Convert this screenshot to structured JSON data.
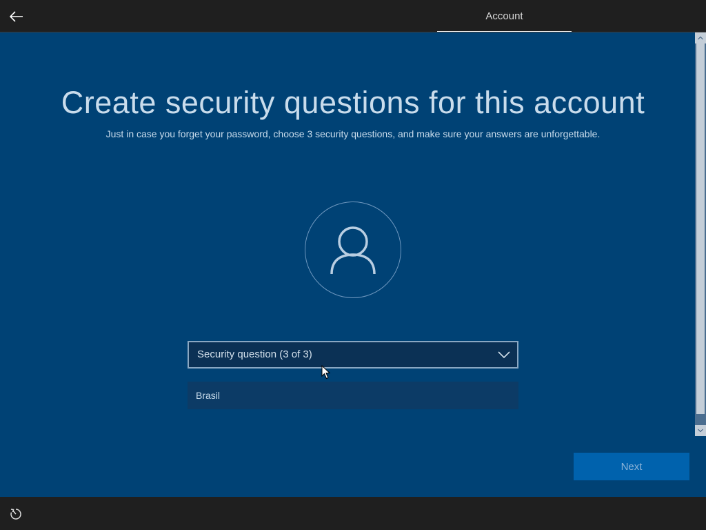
{
  "header": {
    "back_icon": "back-arrow-icon",
    "tab_label": "Account"
  },
  "main": {
    "title": "Create security questions for this account",
    "subtitle": "Just in case you forget your password, choose 3 security questions, and make sure your answers are unforgettable.",
    "avatar_icon": "user-icon",
    "security_question": {
      "selected": "Security question (3 of 3)",
      "icon": "chevron-down-icon"
    },
    "answer": {
      "value": "Brasil"
    },
    "next_label": "Next"
  },
  "footer": {
    "ease_of_access_icon": "ease-of-access-icon"
  },
  "colors": {
    "background": "#004275",
    "bars": "#1f1f1f",
    "button": "#0062ad",
    "text": "#c9dcec"
  }
}
